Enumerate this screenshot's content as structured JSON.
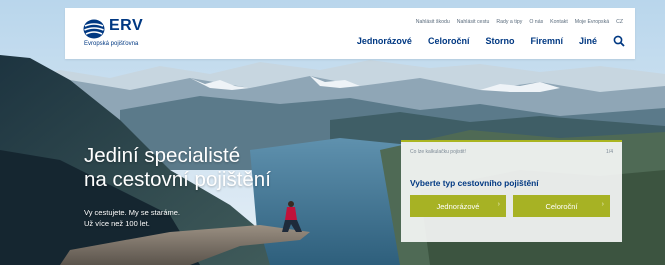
{
  "brand": {
    "name": "ERV",
    "subtitle": "Evropská pojišťovna"
  },
  "top_links": [
    "Nahlásit škodu",
    "Nahlásit cestu",
    "Rady a tipy",
    "O nás",
    "Kontakt",
    "Moje Evropská",
    "CZ"
  ],
  "main_nav": [
    "Jednorázové",
    "Celoroční",
    "Storno",
    "Firemní",
    "Jiné"
  ],
  "hero": {
    "headline_line1": "Jediní specialisté",
    "headline_line2": "na cestovní pojištění",
    "tagline_line1": "Vy cestujete. My se staráme.",
    "tagline_line2": "Už více než 100 let."
  },
  "calculator": {
    "hint": "Co lze kalkulačku pojistit!",
    "step": "1/4",
    "title": "Vyberte typ cestovního pojištění",
    "buttons": [
      "Jednorázové",
      "Celoroční"
    ]
  },
  "colors": {
    "brand_blue": "#003882",
    "accent_green": "#a7b224"
  },
  "icons": {
    "search": "search-icon",
    "logo": "erv-logo-icon",
    "chevron": "chevron-right-icon"
  }
}
